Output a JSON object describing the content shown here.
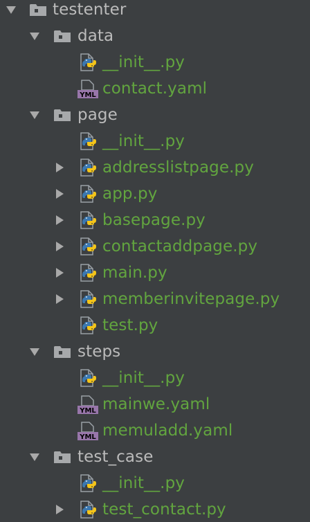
{
  "project_tree": {
    "colors": {
      "background": "#3c3f41",
      "folder_text": "#bbbbbb",
      "file_text": "#62a53f",
      "arrow": "#a9a9a9",
      "folder_icon": "#a7a9ab",
      "python_blue": "#3b78b0",
      "python_yellow": "#f5c518",
      "yaml_badge": "#9876aa"
    },
    "items": [
      {
        "label": "testenter",
        "type": "folder",
        "depth": 0,
        "expanded": true,
        "icon": "folder-icon"
      },
      {
        "label": "data",
        "type": "folder",
        "depth": 1,
        "expanded": true,
        "icon": "folder-icon"
      },
      {
        "label": "__init__.py",
        "type": "python",
        "depth": 2,
        "icon": "python-file-icon"
      },
      {
        "label": "contact.yaml",
        "type": "yaml",
        "depth": 2,
        "icon": "yaml-file-icon"
      },
      {
        "label": "page",
        "type": "folder",
        "depth": 1,
        "expanded": true,
        "icon": "folder-icon"
      },
      {
        "label": "__init__.py",
        "type": "python",
        "depth": 2,
        "icon": "python-file-icon"
      },
      {
        "label": "addresslistpage.py",
        "type": "python",
        "depth": 2,
        "expandable": true,
        "icon": "python-file-icon"
      },
      {
        "label": "app.py",
        "type": "python",
        "depth": 2,
        "expandable": true,
        "icon": "python-file-icon"
      },
      {
        "label": "basepage.py",
        "type": "python",
        "depth": 2,
        "expandable": true,
        "icon": "python-file-icon"
      },
      {
        "label": "contactaddpage.py",
        "type": "python",
        "depth": 2,
        "expandable": true,
        "icon": "python-file-icon"
      },
      {
        "label": "main.py",
        "type": "python",
        "depth": 2,
        "expandable": true,
        "icon": "python-file-icon"
      },
      {
        "label": "memberinvitepage.py",
        "type": "python",
        "depth": 2,
        "expandable": true,
        "icon": "python-file-icon"
      },
      {
        "label": "test.py",
        "type": "python",
        "depth": 2,
        "icon": "python-file-icon"
      },
      {
        "label": "steps",
        "type": "folder",
        "depth": 1,
        "expanded": true,
        "icon": "folder-icon"
      },
      {
        "label": "__init__.py",
        "type": "python",
        "depth": 2,
        "icon": "python-file-icon"
      },
      {
        "label": "mainwe.yaml",
        "type": "yaml",
        "depth": 2,
        "icon": "yaml-file-icon"
      },
      {
        "label": "memuladd.yaml",
        "type": "yaml",
        "depth": 2,
        "icon": "yaml-file-icon"
      },
      {
        "label": "test_case",
        "type": "folder",
        "depth": 1,
        "expanded": true,
        "icon": "folder-icon"
      },
      {
        "label": "__init__.py",
        "type": "python",
        "depth": 2,
        "icon": "python-file-icon"
      },
      {
        "label": "test_contact.py",
        "type": "python",
        "depth": 2,
        "expandable": true,
        "icon": "python-file-icon"
      }
    ]
  }
}
